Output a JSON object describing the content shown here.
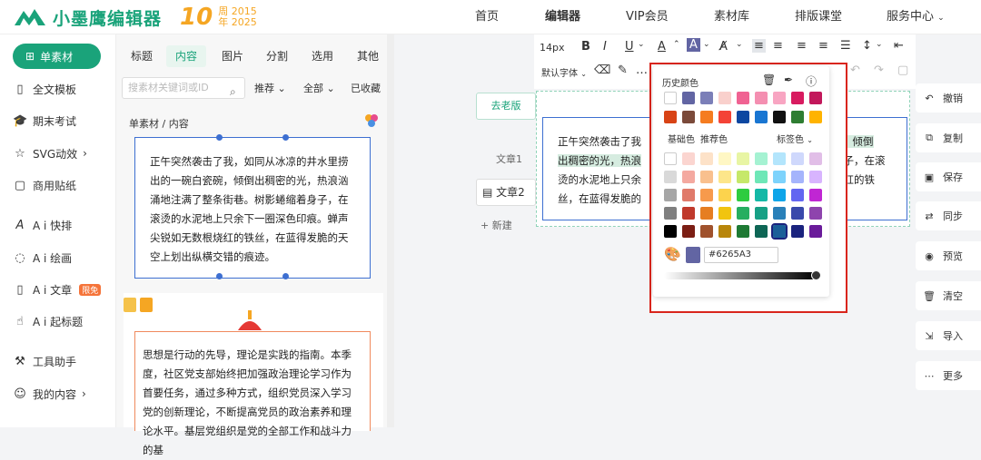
{
  "header": {
    "brand": "小墨鹰编辑器",
    "anniv_number": "10",
    "anniv_line1": "周 2015",
    "anniv_line2": "年 2025",
    "nav": [
      "首页",
      "编辑器",
      "VIP会员",
      "素材库",
      "排版课堂",
      "服务中心"
    ],
    "nav_active": "编辑器"
  },
  "sidebar": {
    "active_label": "单素材",
    "items": [
      {
        "icon": "⊞",
        "label": "单素材"
      },
      {
        "icon": "▯",
        "label": "全文模板"
      },
      {
        "icon": "🎓",
        "label": "期末考试"
      },
      {
        "icon": "☆",
        "label": "SVG动效"
      },
      {
        "icon": "▢",
        "label": "商用贴纸"
      },
      {
        "icon": "A",
        "label": "A i 快排"
      },
      {
        "icon": "◌",
        "label": "A i 绘画"
      },
      {
        "icon": "▯",
        "label": "A i 文章"
      },
      {
        "icon": "☝",
        "label": "A i 起标题"
      },
      {
        "icon": "⚒",
        "label": "工具助手"
      },
      {
        "icon": "☺",
        "label": "我的内容"
      }
    ],
    "free_badge": "限免"
  },
  "panel": {
    "tabs": [
      "标题",
      "内容",
      "图片",
      "分割",
      "选用",
      "其他"
    ],
    "active_tab": "内容",
    "search_placeholder": "搜素材关键词或ID",
    "filter1": "推荐",
    "filter2": "全部",
    "filter3": "已收藏",
    "breadcrumb": "单素材 / 内容",
    "card1_text": "正午突然袭击了我，如同从冰凉的井水里捞出的一碗白瓷碗，倾倒出稠密的光，热浪汹涌地注满了整条街巷。树影蜷缩着身子，在滚烫的水泥地上只余下一圈深色印痕。蝉声尖锐如无数根烧红的铁丝，在蓝得发脆的天空上划出纵横交错的痕迹。",
    "card2_text": "思想是行动的先导，理论是实践的指南。本季度，社区党支部始终把加强政治理论学习作为首要任务，通过多种方式，组织党员深入学习党的创新理论，不断提高党员的政治素养和理论水平。基层党组织是党的全部工作和战斗力的基"
  },
  "editor": {
    "old_version": "去老版",
    "article1": "文章1",
    "article2": "文章2",
    "new_label": "新建",
    "font_size": "14px",
    "font_family": "默认字体",
    "doc_text_a": "正午突然袭击了我",
    "doc_text_b": "瓷碗，倾倒",
    "doc_text_c": "出稠密的光，热浪",
    "doc_text_d": "身子，在滚",
    "doc_text_e": "烫的水泥地上只余",
    "doc_text_f": "烧红的铁",
    "doc_text_g": "丝，在蓝得发脆的"
  },
  "color_picker": {
    "history_label": "历史颜色",
    "basic_label": "基础色",
    "recommend_label": "推荐色",
    "tag_label": "标签色",
    "hex_value": "#6265A3",
    "current_color": "#6265A3",
    "history_row1": [
      "#ffffff",
      "#6265A3",
      "#7b7fb8",
      "#f9d0cc",
      "#f06292",
      "#f48fb1",
      "#f8a5c2",
      "#d81b60",
      "#c2185b"
    ],
    "history_row2": [
      "#d84315",
      "#7b4a3a",
      "#f57c20",
      "#f44336",
      "#0d47a1",
      "#1976d2",
      "#111111",
      "#2e7d32",
      "#ffb300"
    ],
    "grid": [
      [
        "#ffffff",
        "#fbd5d0",
        "#fde2c8",
        "#fff7c4",
        "#e8f5a4",
        "#a5f2d2",
        "#b3e5fc",
        "#cfd8fc",
        "#e1bee7",
        "#f8bbd0"
      ],
      [
        "#d9d9d9",
        "#f4a9a0",
        "#f9c08e",
        "#fde68a",
        "#c6e86a",
        "#6ee7b7",
        "#7dd3fc",
        "#a5b4fc",
        "#d8b4fe",
        "#f9a8d4"
      ],
      [
        "#a6a6a6",
        "#e07a6a",
        "#f79a4c",
        "#fcd34d",
        "#2ecc40",
        "#14b8a6",
        "#0ea5e9",
        "#6366f1",
        "#c026d3",
        "#f43f5e"
      ],
      [
        "#7f7f7f",
        "#c0392b",
        "#e67e22",
        "#f1c40f",
        "#27ae60",
        "#16a085",
        "#2980b9",
        "#3949ab",
        "#8e44ad",
        "#e11d48"
      ],
      [
        "#000000",
        "#7b1e14",
        "#a0522d",
        "#b8860b",
        "#1e7a34",
        "#0e6655",
        "#1a5f99",
        "#1a237e",
        "#6a1b9a",
        "#9f1239"
      ]
    ],
    "grid_shown_cols": 9,
    "selected_cell": [
      4,
      6
    ]
  },
  "right_actions": [
    "撤销",
    "复制",
    "保存",
    "同步",
    "预览",
    "清空",
    "导入",
    "更多"
  ]
}
